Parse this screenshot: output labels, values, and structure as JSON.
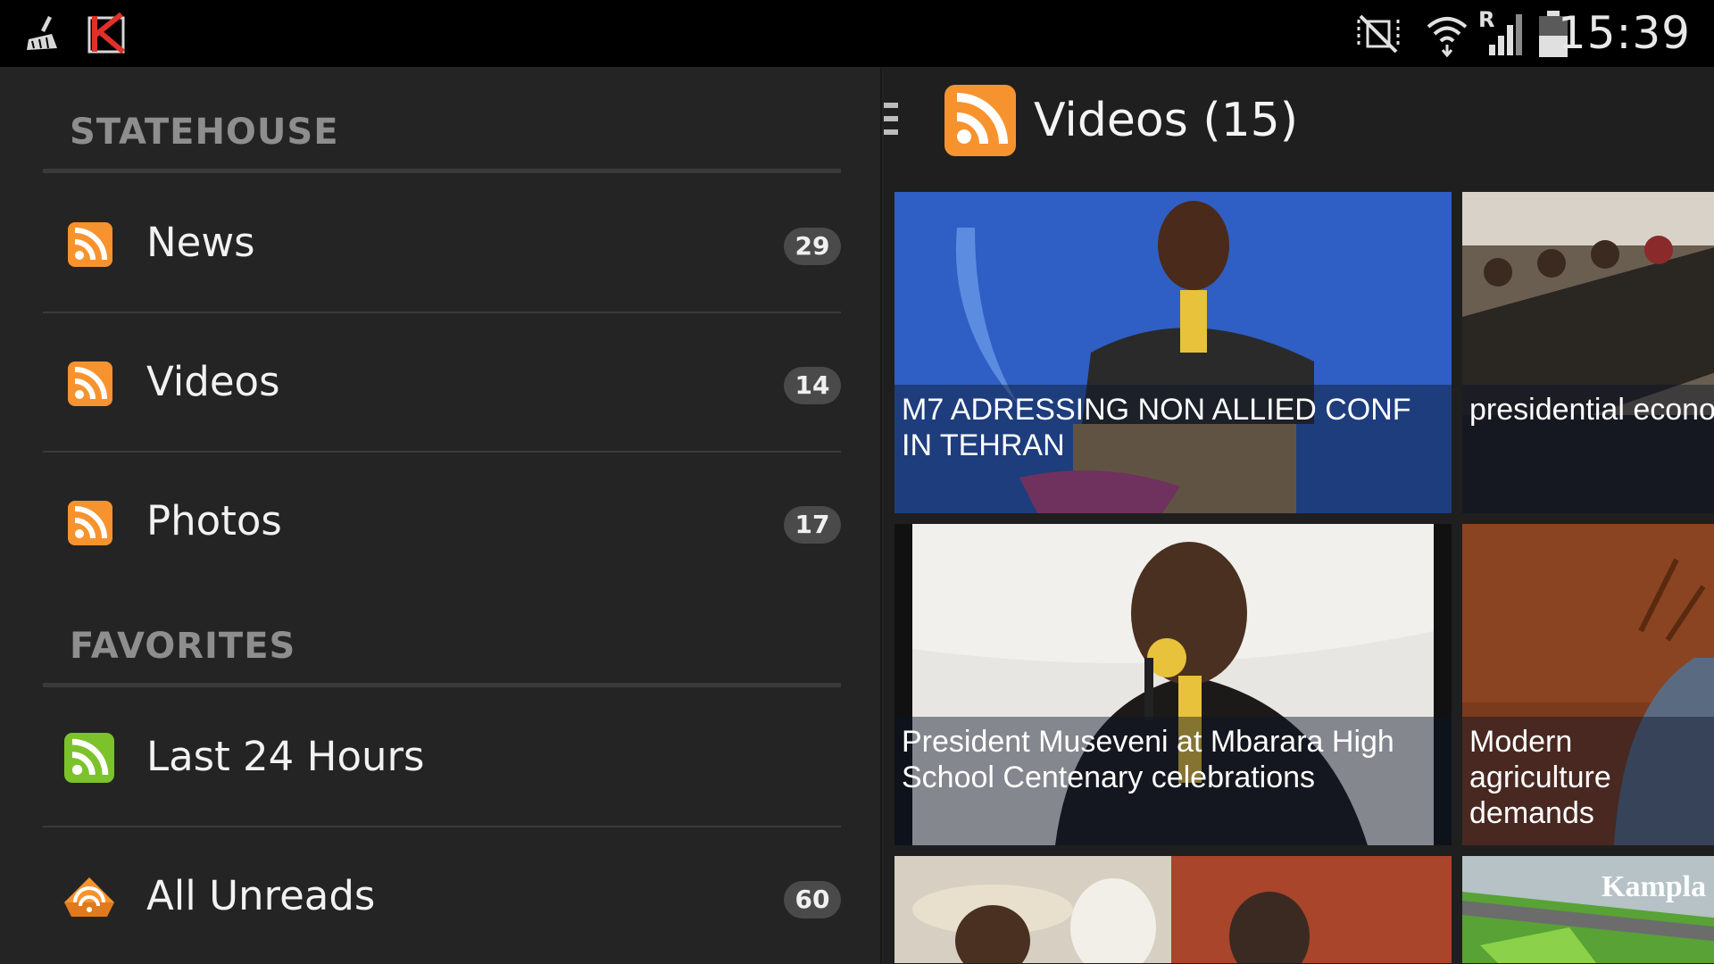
{
  "status_bar": {
    "time": "15:39",
    "icons": [
      "broom-icon",
      "kaspersky-icon",
      "mute-icon",
      "wifi-icon",
      "roaming-signal-icon",
      "battery-icon"
    ],
    "roaming_label": "R"
  },
  "drawer": {
    "sections": [
      {
        "title": "STATEHOUSE",
        "items": [
          {
            "label": "News",
            "count": "29",
            "icon": "rss-icon",
            "icon_color": "#f7932e"
          },
          {
            "label": "Videos",
            "count": "14",
            "icon": "rss-icon",
            "icon_color": "#f7932e"
          },
          {
            "label": "Photos",
            "count": "17",
            "icon": "rss-icon",
            "icon_color": "#f7932e"
          }
        ]
      },
      {
        "title": "FAVORITES",
        "items": [
          {
            "label": "Last 24 Hours",
            "count": "",
            "icon": "rss-icon",
            "icon_color": "#7cc22b"
          },
          {
            "label": "All Unreads",
            "count": "60",
            "icon": "unread-rss-icon",
            "icon_color": "#f7932e"
          }
        ]
      }
    ]
  },
  "content": {
    "title": "Videos (15)",
    "tiles": [
      {
        "caption": "M7 ADRESSING NON ALLIED CONF IN TEHRAN"
      },
      {
        "caption": "presidential econo"
      },
      {
        "caption": "President Museveni at Mbarara High School Centenary celebrations"
      },
      {
        "caption": "Modern agriculture demands"
      },
      {
        "caption": ""
      },
      {
        "caption": "Kampla No"
      }
    ]
  },
  "colors": {
    "accent_orange": "#f7932e",
    "accent_green": "#7cc22b",
    "background": "#222222",
    "status_bar": "#000000"
  }
}
